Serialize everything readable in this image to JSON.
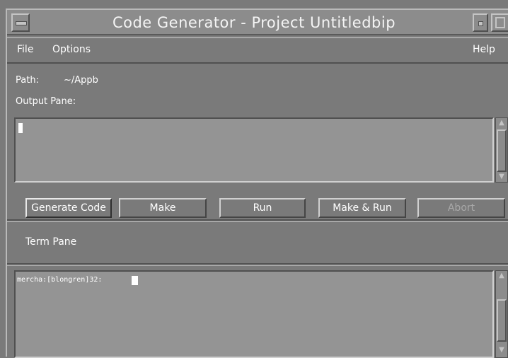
{
  "window": {
    "title": "Code Generator - Project Untitledbip"
  },
  "menubar": {
    "file": "File",
    "options": "Options",
    "help": "Help"
  },
  "path": {
    "label": "Path:",
    "value": "~/Appb"
  },
  "output": {
    "label": "Output Pane:"
  },
  "buttons": {
    "generate": "Generate Code",
    "make": "Make",
    "run": "Run",
    "make_run": "Make & Run",
    "abort": "Abort"
  },
  "term": {
    "label": "Term Pane",
    "prompt": "mercha:[blongren]32:"
  }
}
